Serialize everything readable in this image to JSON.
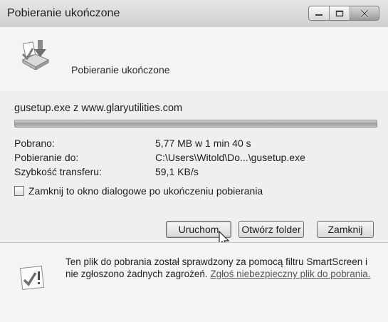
{
  "window": {
    "title": "Pobieranie ukończone"
  },
  "header": {
    "text": "Pobieranie ukończone"
  },
  "download": {
    "filename_line": "gusetup.exe z www.glaryutilities.com",
    "progress": 1.0,
    "rows": [
      {
        "label": "Pobrano:",
        "value": "5,77 MB w 1 min 40 s"
      },
      {
        "label": "Pobieranie do:",
        "value": "C:\\Users\\Witold\\Do...\\gusetup.exe"
      },
      {
        "label": "Szybkość transferu:",
        "value": "59,1 KB/s"
      }
    ],
    "close_after_checkbox": {
      "label": "Zamknij to okno dialogowe po ukończeniu pobierania",
      "checked": false
    }
  },
  "buttons": {
    "run": "Uruchom",
    "open_folder": "Otwórz folder",
    "close": "Zamknij"
  },
  "footer": {
    "text_main": "Ten plik do pobrania został sprawdzony za pomocą filtru SmartScreen i nie zgłoszono żadnych zagrożeń.",
    "link": "Zgłoś niebezpieczny plik do pobrania."
  },
  "icons": [
    "download-icon",
    "minimize-icon",
    "maximize-icon",
    "close-icon",
    "security-check-icon",
    "mouse-cursor-icon"
  ]
}
